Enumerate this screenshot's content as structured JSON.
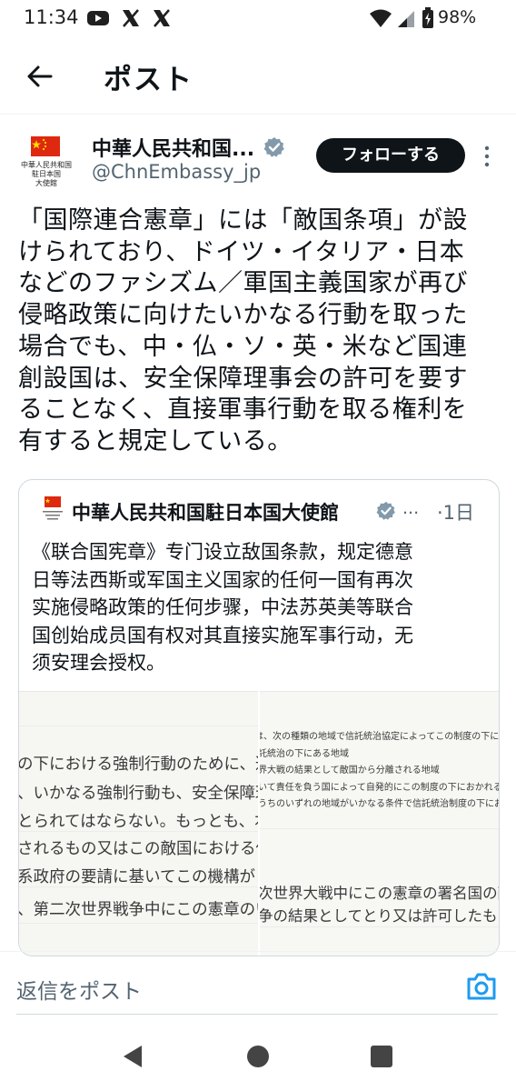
{
  "status_bar": {
    "time": "11:34",
    "battery": "98%",
    "icons": [
      "youtube-icon",
      "x-icon",
      "x-icon",
      "wifi-icon",
      "signal-icon",
      "battery-icon"
    ]
  },
  "header": {
    "title": "ポスト"
  },
  "author": {
    "name": "中華人民共和国...",
    "handle": "@ChnEmbassy_jp",
    "avatar_caption": [
      "中華人民共和国",
      "駐日本国",
      "大使館"
    ],
    "follow_label": "フォローする"
  },
  "tweet": {
    "text": "「国際連合憲章」には「敵国条項」が設\nけられており、ドイツ・イタリア・日本\nなどのファシズム／軍国主義国家が再び\n侵略政策に向けたいかなる行動を取った\n場合でも、中・仏・ソ・英・米など国連\n創設国は、安全保障理事会の許可を要す\nることなく、直接軍事行動を取る権利を\n有すると規定している。"
  },
  "quote": {
    "name": "中華人民共和国駐日本国大使館",
    "dots": "...",
    "time": "·1日",
    "text": "《联合国宪章》专门设立敌国条款，规定德意\n日等法西斯或军国主义国家的任何一国有再次\n实施侵略政策的任何步骤，中法苏英美等联合\n国创始成员国有权对其直接实施军事行动，无\n须安理会授权。",
    "image_left_lines": [
      "の下における強制行動のために、適当な",
      "、いかなる強制行動も、安全保障理事会",
      "とられてはならない。もっとも、本条",
      "されるもの又はこの敵国における侵略",
      "系政府の要請に基いてこの機構がこの敵",
      "、第二次世界戦争中にこの憲章のいず"
    ],
    "image_right_small_lines": [
      "は、次の種類の地域で信託統治協定によってこの制度の下におかれるも",
      "託統治の下にある地域",
      "界大戦の結果として敵国から分離される地域",
      "いて責任を負う国によって自発的にこの制度の下におかれる地域",
      "うちのいずれの地域がいかなる条件で信託統治制度の下におかれるか"
    ],
    "image_right_large_lines": [
      "次世界大戦中にこの憲章の署名国の敵であ",
      "争の結果としてとり又は許可したものを無"
    ]
  },
  "reply": {
    "placeholder": "返信をポスト"
  },
  "colors": {
    "text": "#0f1419",
    "secondary": "#536471",
    "verified": "#829aab",
    "camera": "#1d9bf0",
    "flag_red": "#de2910",
    "flag_star": "#ffde00"
  }
}
